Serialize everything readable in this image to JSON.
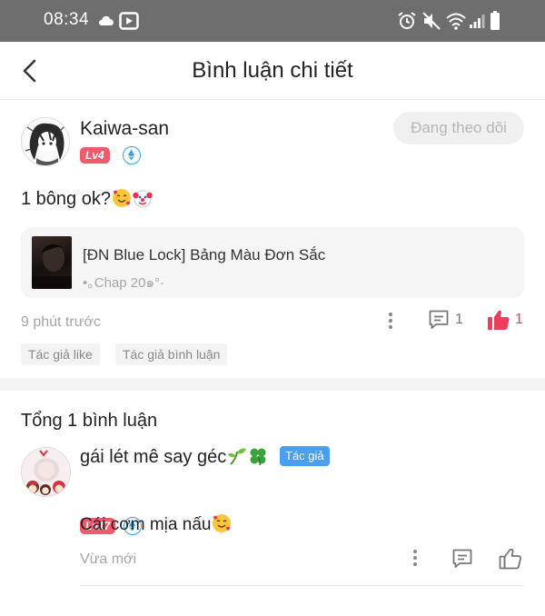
{
  "status_bar": {
    "time": "08:34",
    "left_icons": [
      "cloud-icon",
      "media-icon"
    ],
    "right_icons": [
      "alarm-icon",
      "mute-icon",
      "wifi-icon",
      "signal-icon",
      "battery-icon"
    ]
  },
  "header": {
    "title": "Bình luận chi tiết",
    "back_icon": "chevron-left-icon"
  },
  "post": {
    "username": "Kaiwa-san",
    "level": "Lv4",
    "follow_label": "Đang theo dõi",
    "text": "1 bông ok?",
    "emojis": [
      "smiling-face-with-hearts",
      "clown-face"
    ],
    "story": {
      "title": "[ĐN Blue Lock] Bảng Màu Đơn Sắc",
      "chapter": "•｡Chap 20๑°·"
    },
    "time": "9 phút trước",
    "comment_count": "1",
    "like_count": "1",
    "tags": [
      "Tác giả like",
      "Tác giả bình luận"
    ]
  },
  "comments_section": {
    "total_label": "Tổng 1 bình luận",
    "comments": [
      {
        "username": "gái lét mê say géc",
        "username_emojis": [
          "seedling",
          "four-leaf-clover"
        ],
        "author_badge": "Tác giả",
        "level": "Lv17",
        "text": "Cái cơm mịa nấu",
        "text_emoji": "smiling-face-with-hearts",
        "time": "Vừa mới"
      }
    ]
  },
  "colors": {
    "status_bar_bg": "#6e6e6e",
    "level_badge": "#ef5a6d",
    "author_badge": "#4a9ff0",
    "like_active": "#ec3f5c",
    "muted_text": "#a5a5a5"
  }
}
